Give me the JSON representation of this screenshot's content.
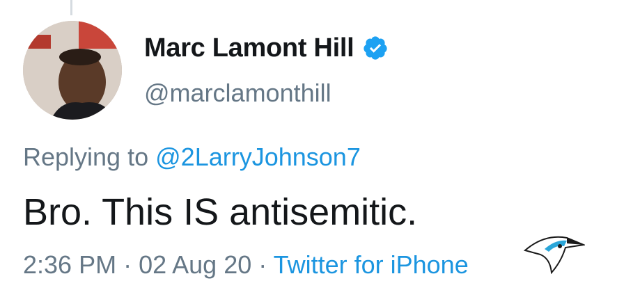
{
  "author": {
    "name": "Marc Lamont Hill",
    "handle": "@marclamonthill",
    "verified": true
  },
  "reply": {
    "prefix": "Replying to",
    "mention": "@2LarryJohnson7"
  },
  "tweet": {
    "text": "Bro. This IS antisemitic."
  },
  "meta": {
    "time": "2:36 PM",
    "separator1": " · ",
    "date": "02 Aug 20",
    "separator2": " · ",
    "source": "Twitter for iPhone"
  },
  "icons": {
    "verified": "verified-badge-icon",
    "logo": "bird-logo-icon"
  },
  "colors": {
    "text": "#14171a",
    "secondary": "#657786",
    "link": "#1b95e0",
    "verified": "#1da1f2"
  }
}
